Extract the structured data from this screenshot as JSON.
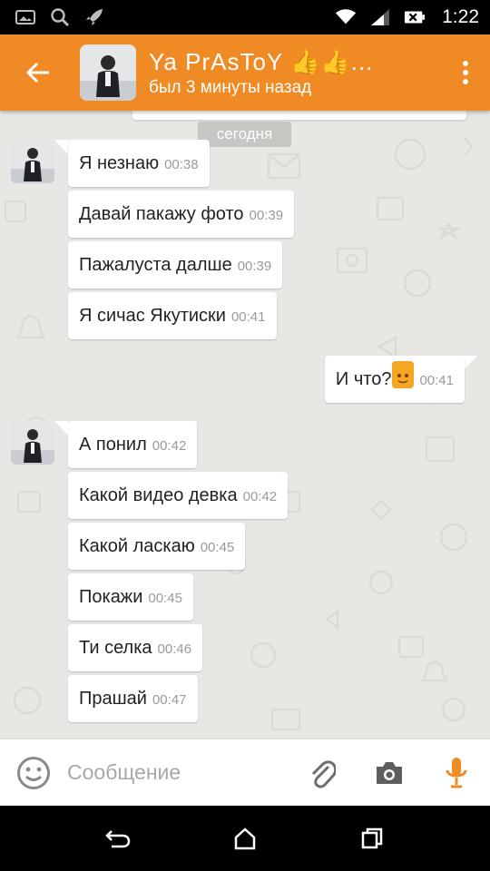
{
  "status_bar": {
    "time": "1:22",
    "left_icons": [
      "image-icon",
      "search-icon",
      "rocket-icon"
    ],
    "right_icons": [
      "wifi-icon",
      "signal-icon",
      "battery-icon"
    ]
  },
  "header": {
    "title": "Ya  PrAsToY 👍👍...",
    "subtitle": "был 3 минуты назад",
    "accent": "#f08a24"
  },
  "date_divider": "сегодня",
  "messages": [
    {
      "dir": "in",
      "text": "Я незнаю",
      "time": "00:38"
    },
    {
      "dir": "in",
      "text": "Давай пакажу фото",
      "time": "00:39"
    },
    {
      "dir": "in",
      "text": "Пажалуста  далше",
      "time": "00:39"
    },
    {
      "dir": "in",
      "text": "Я сичас Якутиски",
      "time": "00:41"
    },
    {
      "dir": "out",
      "text": "И что?",
      "emoji": "smiley-emoji",
      "time": "00:41"
    },
    {
      "dir": "in",
      "text": "А понил",
      "time": "00:42"
    },
    {
      "dir": "in",
      "text": "Какой видео девка",
      "time": "00:42"
    },
    {
      "dir": "in",
      "text": "Какой ласкаю",
      "time": "00:45"
    },
    {
      "dir": "in",
      "text": "Покажи",
      "time": "00:45"
    },
    {
      "dir": "in",
      "text": "Ти селка",
      "time": "00:46"
    },
    {
      "dir": "in",
      "text": "Прашай",
      "time": "00:47"
    }
  ],
  "composer": {
    "placeholder": "Сообщение",
    "icons": [
      "smile-icon",
      "paperclip-icon",
      "camera-icon",
      "microphone-icon"
    ],
    "mic_color": "#f08a24"
  },
  "nav_bar": {
    "icons": [
      "back-icon",
      "home-icon",
      "recents-icon"
    ]
  }
}
